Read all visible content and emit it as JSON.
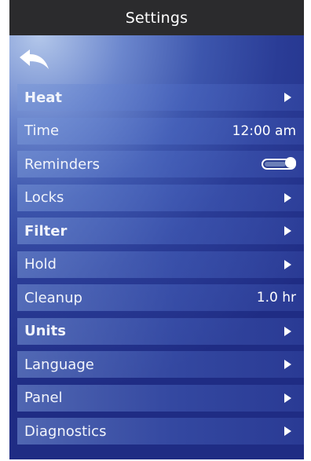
{
  "header": {
    "title": "Settings"
  },
  "icons": {
    "back": "back-arrow-icon",
    "chevron": "right-triangle-icon",
    "toggle": "toggle-switch"
  },
  "colors": {
    "header_bg": "#2b2b2d",
    "screen_bg": "#2a3c96",
    "text": "#ffffff"
  },
  "menu": {
    "items": [
      {
        "label": "Heat",
        "control": "arrow"
      },
      {
        "label": "Time",
        "control": "value",
        "value": "12:00 am"
      },
      {
        "label": "Reminders",
        "control": "toggle",
        "state": "on"
      },
      {
        "label": "Locks",
        "control": "arrow"
      },
      {
        "label": "Filter",
        "control": "arrow"
      },
      {
        "label": "Hold",
        "control": "arrow"
      },
      {
        "label": "Cleanup",
        "control": "value",
        "value": "1.0 hr"
      },
      {
        "label": "Units",
        "control": "arrow"
      },
      {
        "label": "Language",
        "control": "arrow"
      },
      {
        "label": "Panel",
        "control": "arrow"
      },
      {
        "label": "Diagnostics",
        "control": "arrow"
      }
    ]
  }
}
